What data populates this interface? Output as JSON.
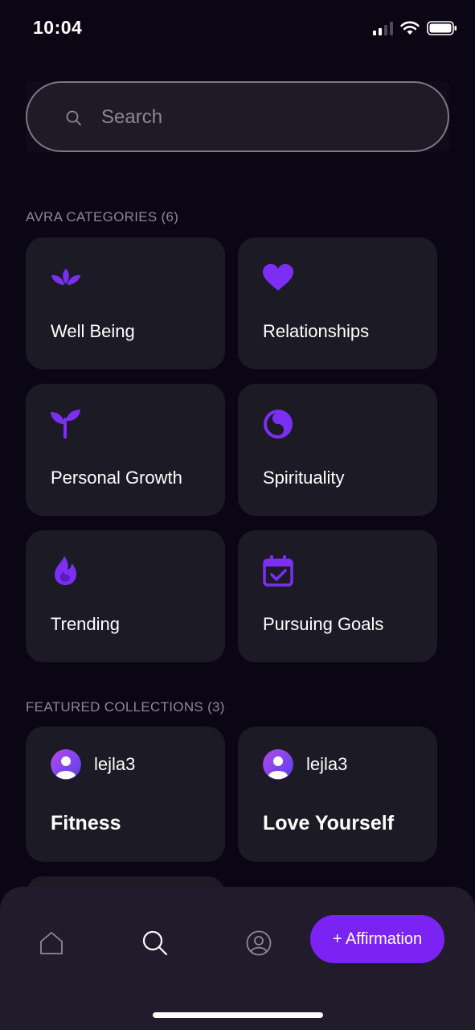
{
  "status_bar": {
    "time": "10:04"
  },
  "search": {
    "placeholder": "Search"
  },
  "categories": {
    "title": "AVRA CATEGORIES (6)",
    "items": [
      {
        "label": "Well Being",
        "icon": "lotus-icon"
      },
      {
        "label": "Relationships",
        "icon": "heart-icon"
      },
      {
        "label": "Personal Growth",
        "icon": "sprout-icon"
      },
      {
        "label": "Spirituality",
        "icon": "yin-yang-icon"
      },
      {
        "label": "Trending",
        "icon": "flame-icon"
      },
      {
        "label": "Pursuing Goals",
        "icon": "calendar-check-icon"
      }
    ]
  },
  "featured": {
    "title": "FEATURED COLLECTIONS (3)",
    "items": [
      {
        "user": "lejla3",
        "title": "Fitness"
      },
      {
        "user": "lejla3",
        "title": "Love Yourself"
      }
    ]
  },
  "bottom_nav": {
    "add_label": "+ Affirmation"
  },
  "colors": {
    "accent": "#7a23f2",
    "icon": "#7b2ff3",
    "card": "#1c1a25",
    "background": "#0b0613"
  }
}
